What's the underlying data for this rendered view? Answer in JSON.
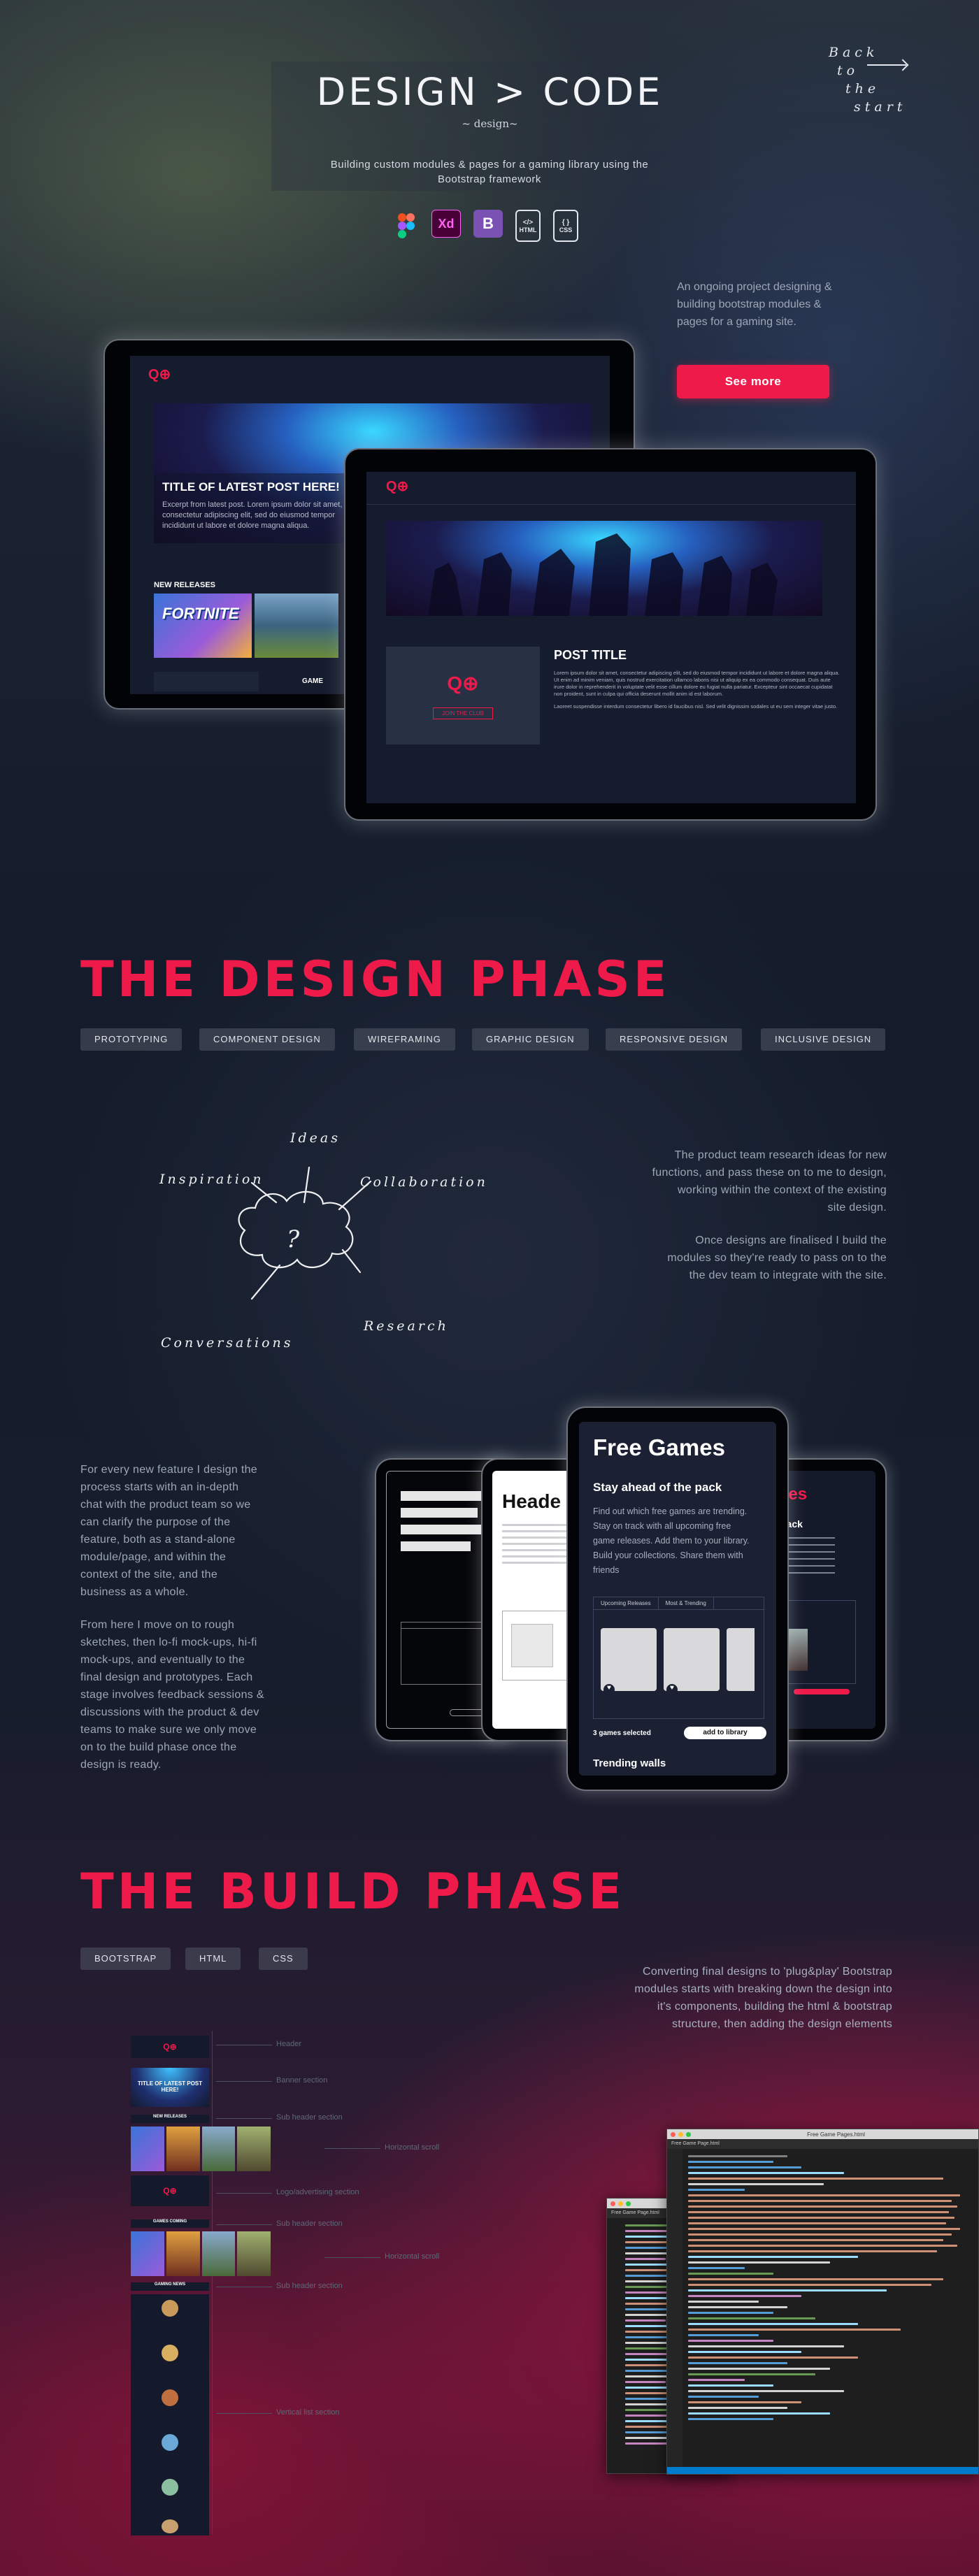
{
  "header": {
    "title": "DESIGN > CODE",
    "subtitle": "~ design~",
    "tagline_1": "Building custom modules & pages for a gaming library using the",
    "tagline_2": "Bootstrap framework",
    "back_1": "Back",
    "back_2": "to",
    "back_3": "the",
    "back_4": "start"
  },
  "tools": [
    {
      "name": "figma-icon",
      "label": ""
    },
    {
      "name": "xd-icon",
      "label": "Xd"
    },
    {
      "name": "bootstrap-icon",
      "label": "B"
    },
    {
      "name": "html-icon",
      "label": "HTML"
    },
    {
      "name": "css-icon",
      "label": "CSS"
    }
  ],
  "intro": {
    "line_1": "An ongoing project designing &",
    "line_2": "building bootstrap modules &",
    "line_3": "pages for a gaming site.",
    "button": "See more"
  },
  "tablet_back": {
    "hero_title": "TITLE OF LATEST POST HERE!",
    "hero_text": "Excerpt from latest post. Lorem ipsum dolor sit amet, consectetur adipiscing elit, sed do eiusmod tempor incididunt ut labore et dolore magna aliqua.",
    "section": "NEW RELEASES",
    "thumb_1": "FORTNITE",
    "extra": "GAME"
  },
  "tablet_front": {
    "post_title": "POST TITLE",
    "post_text": "Lorem ipsum dolor sit amet, consectetur adipiscing elit, sed do eiusmod tempor incididunt ut labore et dolore magna aliqua. Ut enim ad minim veniam, quis nostrud exercitation ullamco laboris nisi ut aliquip ex ea commodo consequat. Duis aute irure dolor in reprehenderit in voluptate velit esse cillum dolore eu fugiat nulla pariatur. Excepteur sint occaecat cupidatat non proident, sunt in culpa qui officia deserunt mollit anim id est laborum.",
    "post_text_2": "Laoreet suspendisse interdum consectetur libero id faucibus nisl. Sed velit dignissim sodales ut eu sem integer vitae justo.",
    "join": "JOIN THE CLUB"
  },
  "design_phase": {
    "heading": "THE DESIGN PHASE",
    "tags": [
      "PROTOTYPING",
      "COMPONENT DESIGN",
      "WIREFRAMING",
      "GRAPHIC DESIGN",
      "RESPONSIVE DESIGN",
      "INCLUSIVE DESIGN"
    ],
    "sketch": {
      "ideas": "Ideas",
      "inspiration": "Inspiration",
      "collaboration": "Collaboration",
      "research": "Research",
      "conversations": "Conversations",
      "question": "?"
    },
    "right_p1_l1": "The product team research ideas for new",
    "right_p1_l2": "functions, and pass these on to me to design,",
    "right_p1_l3": "working within the context of the existing",
    "right_p1_l4": "site design.",
    "right_p2_l1": "Once designs are finalised I build the",
    "right_p2_l2": "modules so they're ready to pass on to the",
    "right_p2_l3": "the dev team to integrate with the site.",
    "left_p1": [
      "For every new feature I design the",
      "process starts with an in-depth",
      "chat with the product team so we",
      "can clarify the purpose of the",
      "feature, both as a stand-alone",
      "module/page, and within the",
      "context of the site, and the",
      "business as a whole."
    ],
    "left_p2": [
      "From here I move on to rough",
      "sketches, then lo-fi mock-ups, hi-fi",
      "mock-ups, and eventually to the",
      "final design and prototypes. Each",
      "stage involves feedback sessions &",
      "discussions with the product & dev",
      "teams to make sure we only move",
      "on to the build phase once the",
      "design is ready."
    ]
  },
  "phones": {
    "mid_header": "Heade",
    "main_title": "Free Games",
    "main_sub": "Stay ahead of the pack",
    "main_text": "Find out which free games are trending. Stay on track with all upcoming free game releases. Add them to your library. Build your collections. Share them with friends",
    "tab_1": "Upcoming Releases",
    "tab_2": "Most & Trending",
    "selected": "3 games selected",
    "add_btn": "add to library",
    "trending": "Trending walls",
    "right_title": "Games",
    "right_sub": "of the pack",
    "right_walls": "alls"
  },
  "build_phase": {
    "heading": "THE BUILD PHASE",
    "tags": [
      "BOOTSTRAP",
      "HTML",
      "CSS"
    ],
    "text_1": "Converting final designs to 'plug&play' Bootstrap",
    "text_2": "modules starts with breaking down the design into",
    "text_3": "it's components, building the html & bootstrap",
    "text_4": "structure, then adding the design elements",
    "labels": [
      "Header",
      "Banner section",
      "Sub header section",
      "Horizontal scroll",
      "Logo/advertising section",
      "Sub header section",
      "Horizontal scroll",
      "Sub header section",
      "Vertical list section"
    ],
    "stack_title": "TITLE OF LATEST POST HERE!",
    "stack_new": "NEW RELEASES",
    "stack_coming": "GAMES COMING",
    "stack_news": "GAMING NEWS",
    "code_title_1": "Free Game Pages.html",
    "code_title_2": "Free Game Page.html"
  },
  "colors": {
    "accent": "#ee1a4a",
    "muted_text": "#9ea7b6"
  }
}
